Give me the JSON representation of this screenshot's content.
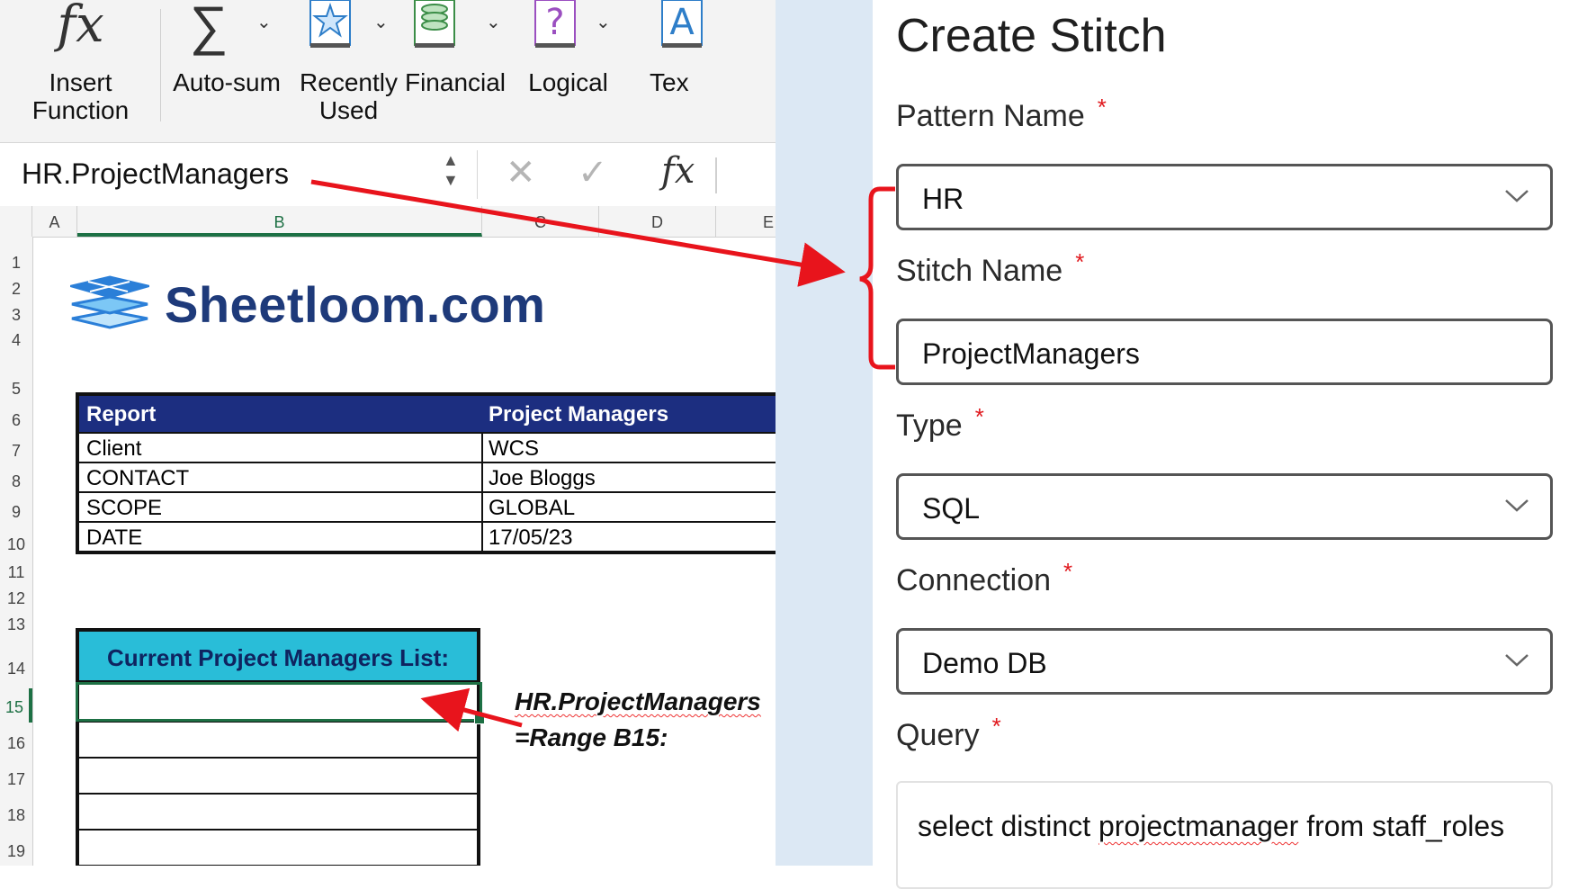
{
  "ribbon": {
    "items": [
      {
        "label": "Insert\nFunction",
        "icon": "fx-icon"
      },
      {
        "label": "Auto-sum",
        "icon": "sigma-icon"
      },
      {
        "label": "Recently\nUsed",
        "icon": "star-book-icon"
      },
      {
        "label": "Financial",
        "icon": "coins-book-icon"
      },
      {
        "label": "Logical",
        "icon": "question-book-icon"
      },
      {
        "label": "Tex",
        "icon": "text-book-icon"
      }
    ]
  },
  "formula_bar": {
    "name_box": "HR.ProjectManagers"
  },
  "sheet": {
    "columns": [
      "A",
      "B",
      "C",
      "D",
      "E"
    ],
    "selected_column": "B",
    "rows": [
      "1",
      "2",
      "3",
      "4",
      "5",
      "6",
      "7",
      "8",
      "9",
      "10",
      "11",
      "12",
      "13",
      "14",
      "15",
      "16",
      "17",
      "18",
      "19"
    ],
    "selected_row": "15",
    "brand": "Sheetloom.com",
    "report": {
      "header": [
        "Report",
        "Project Managers"
      ],
      "rows": [
        [
          "Client",
          "WCS"
        ],
        [
          "CONTACT",
          "Joe Bloggs"
        ],
        [
          "SCOPE",
          "GLOBAL"
        ],
        [
          "DATE",
          "17/05/23"
        ]
      ]
    },
    "pm_list_header": "Current Project Managers List:",
    "note_line1": "HR.ProjectManagers",
    "note_line2": "=Range B15:",
    "colors": {
      "header_navy": "#1c2e80",
      "header_cyan": "#29bdd8",
      "selection_green": "#1d7044",
      "brand_blue": "#1e3a7a"
    }
  },
  "form": {
    "title": "Create Stitch",
    "pattern_name_label": "Pattern Name",
    "pattern_name_value": "HR",
    "stitch_name_label": "Stitch Name",
    "stitch_name_value": "ProjectManagers",
    "type_label": "Type",
    "type_value": "SQL",
    "connection_label": "Connection",
    "connection_value": "Demo DB",
    "query_label": "Query",
    "query_pre": "select distinct ",
    "query_word": "projectmanager",
    "query_post": " from staff_roles",
    "required_mark": "*",
    "colors": {
      "required": "#e0191e",
      "annotation_red": "#e8141c"
    }
  }
}
